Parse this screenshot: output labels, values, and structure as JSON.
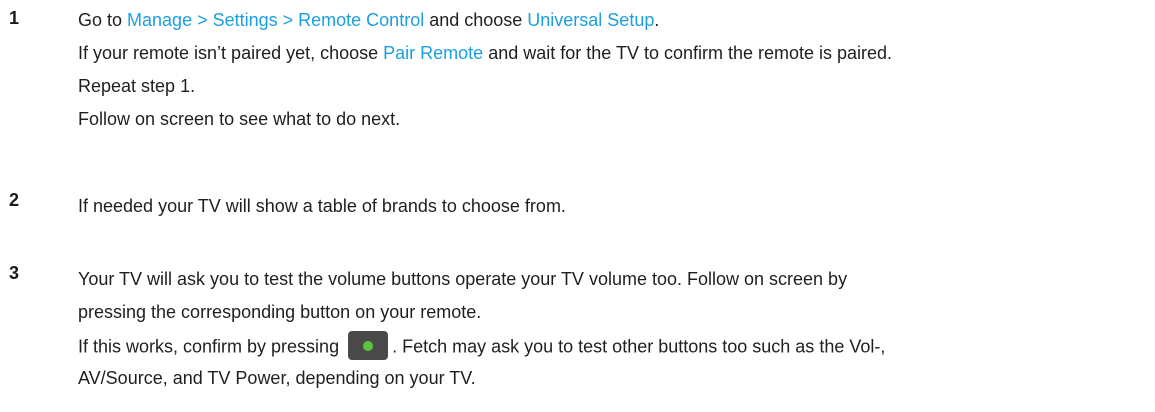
{
  "steps": [
    {
      "number": "1",
      "line1": {
        "pre": "Go to ",
        "link1": "Manage > Settings > Remote Control",
        "mid": " and choose ",
        "link2": "Universal Setup",
        "post": "."
      },
      "line2": {
        "pre": "If your remote isn’t paired yet, choose ",
        "link": "Pair Remote",
        "post": " and wait for the TV to confirm the remote is paired."
      },
      "line3": "Repeat step 1.",
      "line4": "Follow on screen to see what to do next."
    },
    {
      "number": "2",
      "line1": "If needed your TV will show a table of brands to choose from."
    },
    {
      "number": "3",
      "line1": "Your TV will ask you to test the volume buttons operate your TV volume too. Follow on screen by",
      "line2": "pressing the corresponding button on your remote.",
      "line3": {
        "pre": "If this works, confirm by pressing ",
        "button_icon": "green-button-icon",
        "post": ". Fetch may ask you to test other buttons too such as the Vol-,"
      },
      "line4": "AV/Source, and TV Power, depending on your TV."
    }
  ],
  "colors": {
    "link": "#1a9fe0",
    "text": "#1f1f1f",
    "button_bg": "#4a4a4a",
    "button_dot": "#5fc43d"
  }
}
